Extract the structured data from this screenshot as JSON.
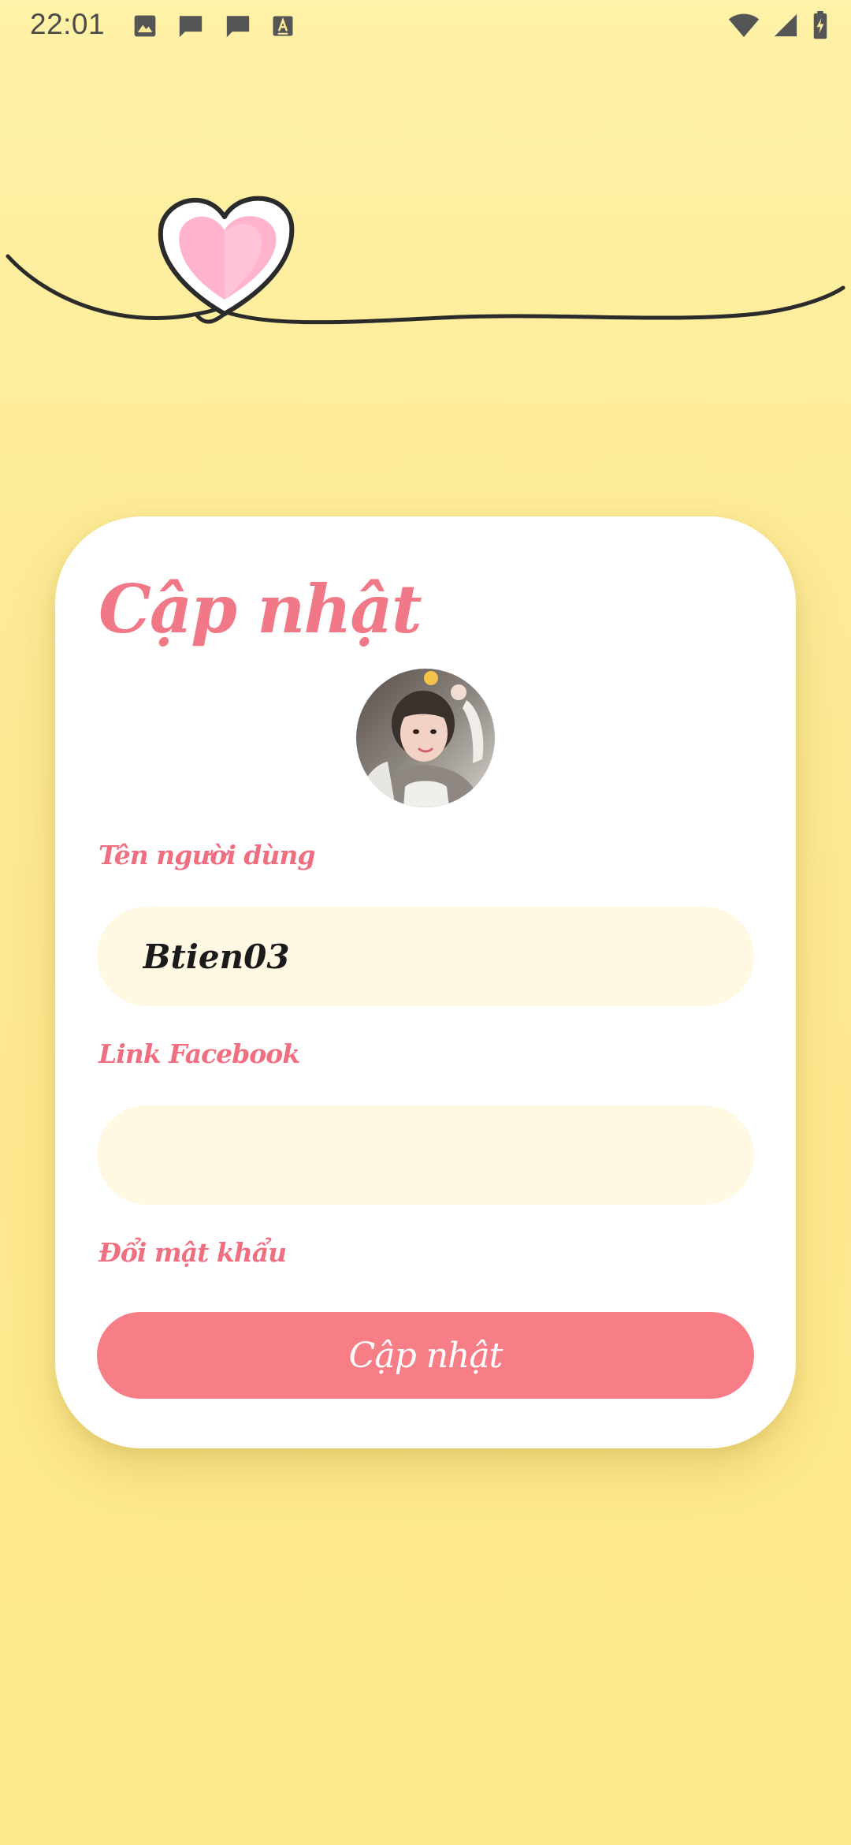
{
  "status_bar": {
    "time": "22:01",
    "left_icons": [
      "image-icon",
      "message-icon",
      "message-icon",
      "text-a-icon"
    ],
    "right_icons": [
      "wifi-icon",
      "signal-icon",
      "battery-charging-icon"
    ]
  },
  "decoration": {
    "icon": "heart-icon",
    "heart_color": "#ffb3cc",
    "line_color": "#2b2b2b"
  },
  "card": {
    "title": "Cập nhật",
    "avatar_icon": "avatar-photo",
    "username": {
      "label": "Tên người dùng",
      "value": "Btien03"
    },
    "facebook": {
      "label": "Link Facebook",
      "value": ""
    },
    "change_password_label": "Đổi mật khẩu",
    "submit_label": "Cập nhật"
  },
  "colors": {
    "background": "#fdeb97",
    "accent_pink": "#f17886",
    "button": "#f77d87",
    "input_background": "#fff9e4",
    "card": "#ffffff"
  }
}
